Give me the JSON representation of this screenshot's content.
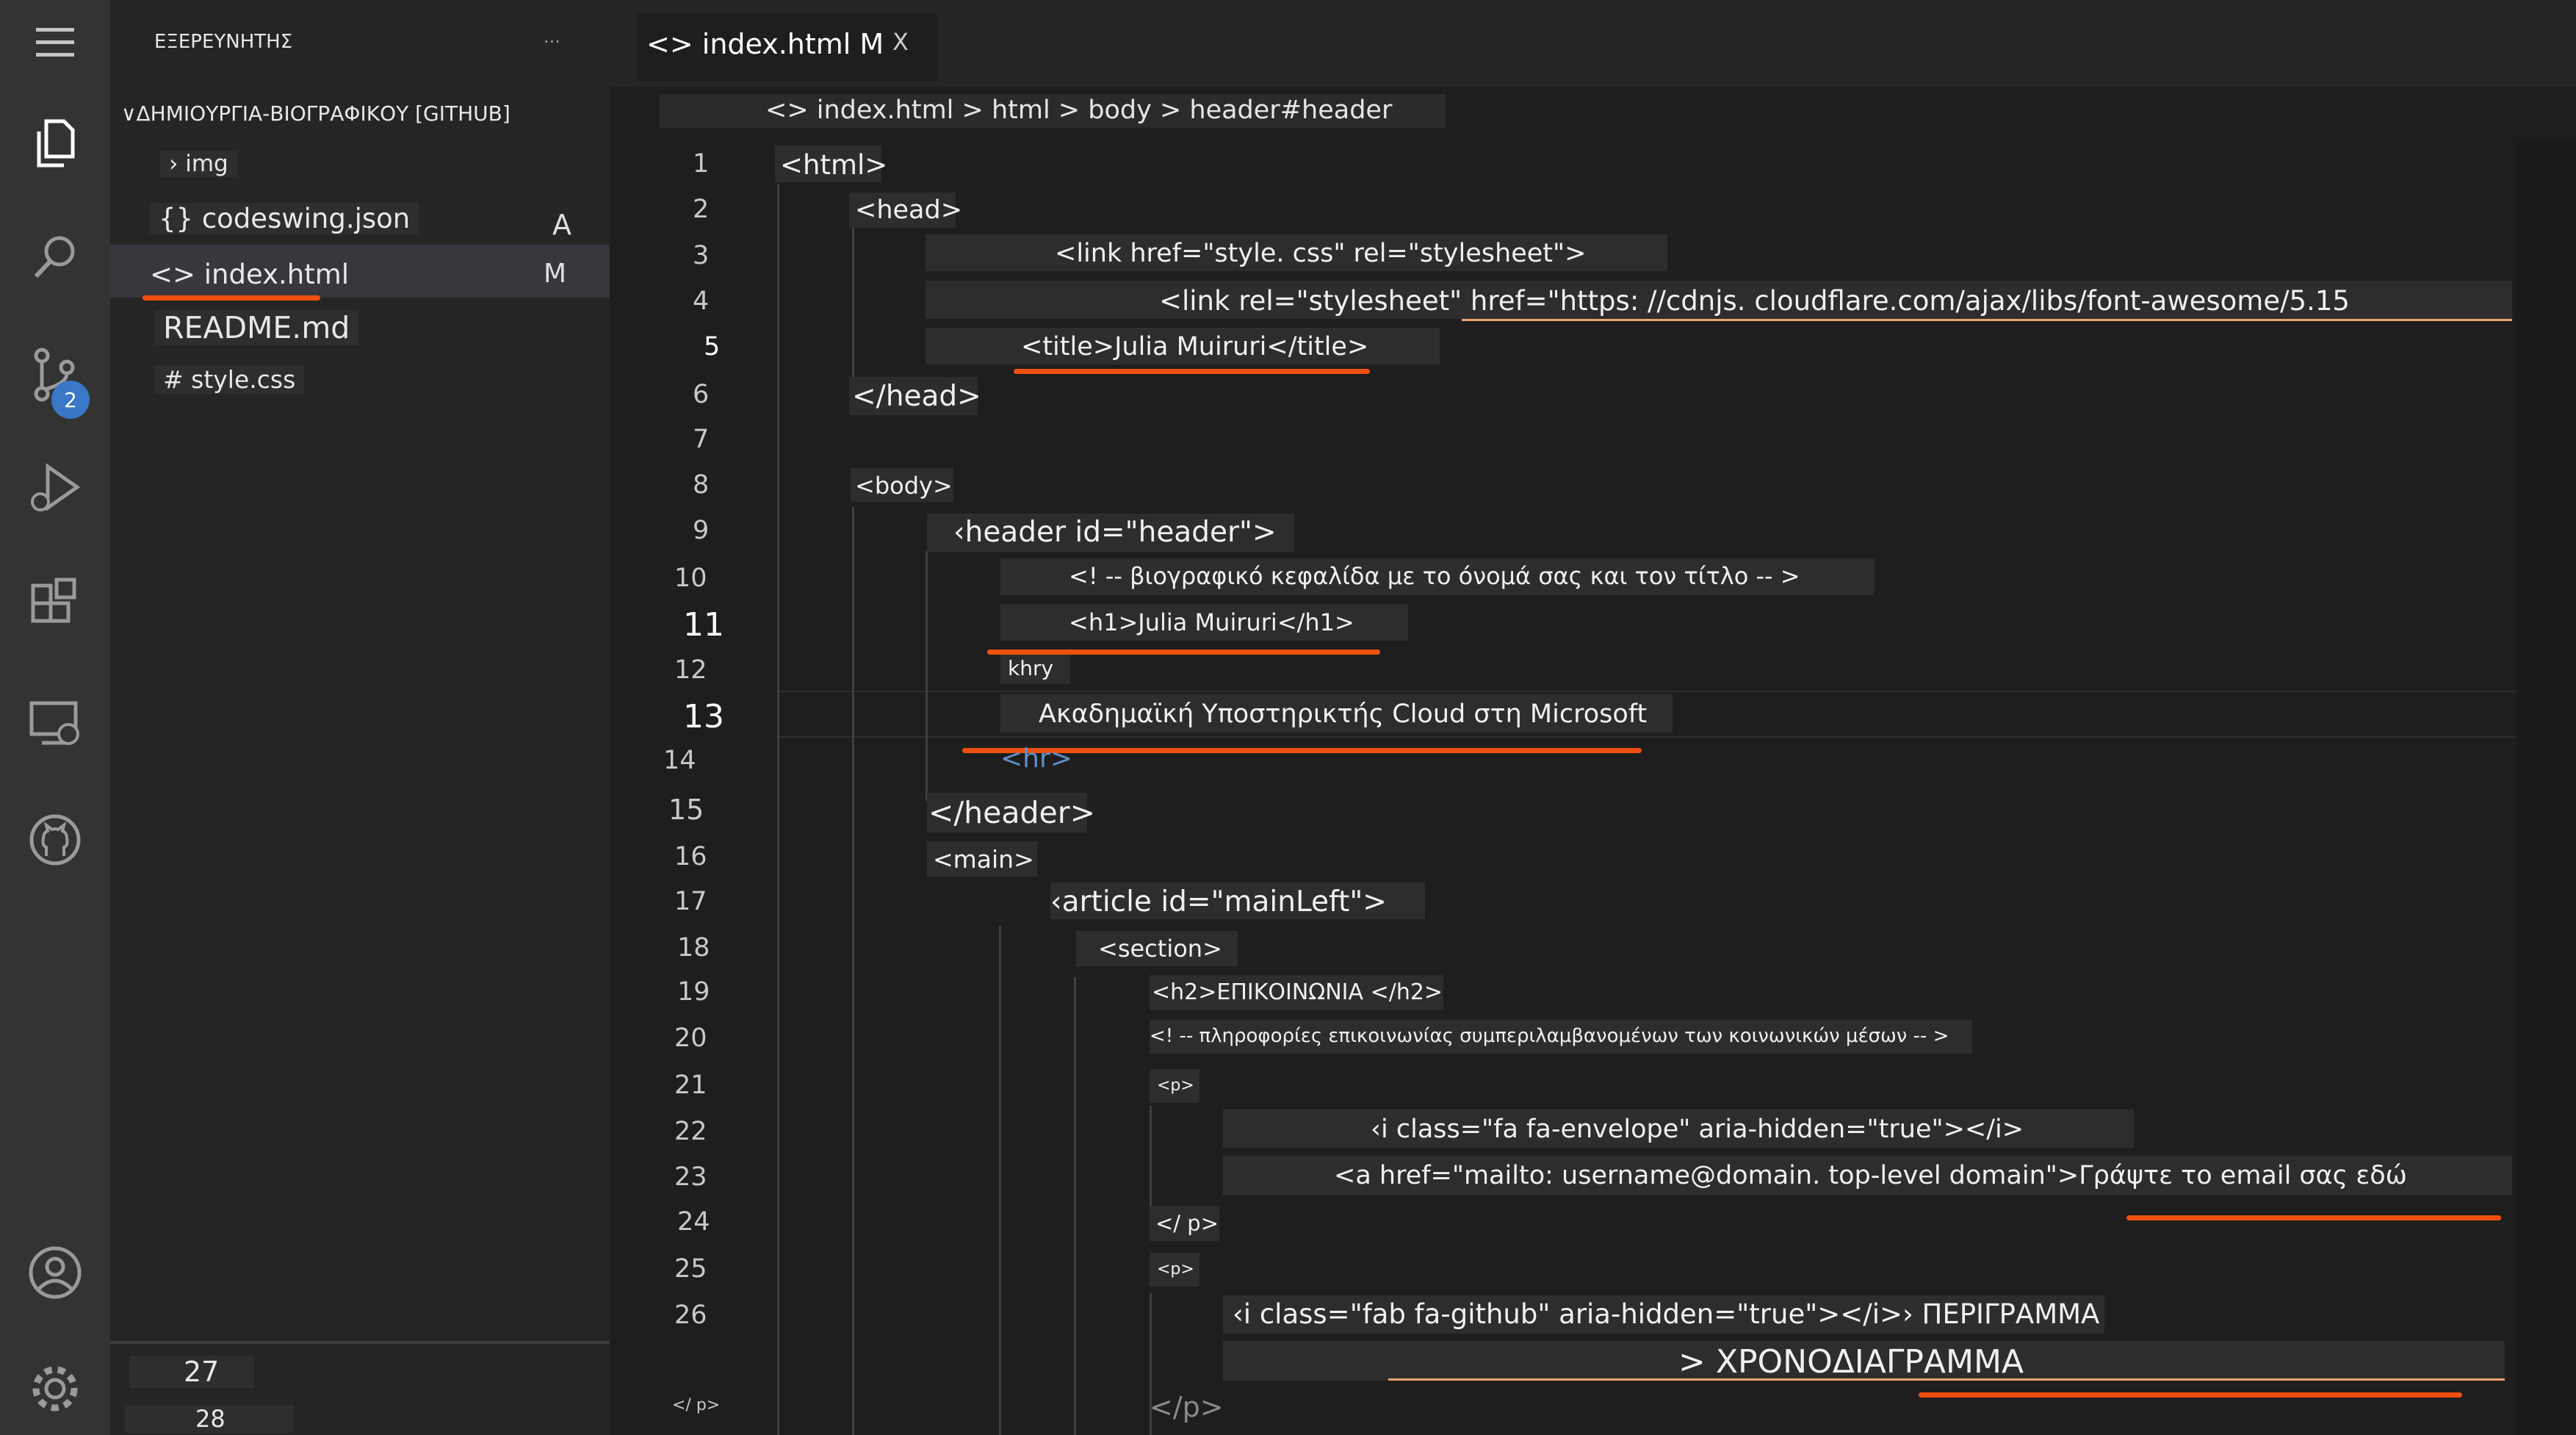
{
  "activity_bar": {
    "icons": [
      "menu-icon",
      "files-icon",
      "search-icon",
      "source-control-icon",
      "run-debug-icon",
      "extensions-icon",
      "remote-explorer-icon",
      "github-icon",
      "account-icon",
      "gear-icon"
    ],
    "scm_badge": "2"
  },
  "explorer": {
    "title": "ΕΞΕΡΕΥΝΗΤΗΣ",
    "more": "...",
    "folder": "ΔΗΜΙΟΥΡΓΙΑ-ΒΙΟΓΡΑΦΙΚΟΥ [GITHUB]",
    "items": [
      {
        "label": "› img",
        "status": ""
      },
      {
        "label": "{} codeswing.json",
        "status": "A"
      },
      {
        "label": "<> index.html",
        "status": "M"
      },
      {
        "label": "README.md",
        "status": ""
      },
      {
        "label": "# style.css",
        "status": ""
      }
    ],
    "bottom_numbers": [
      "27",
      "28"
    ]
  },
  "tab": {
    "label": "<> index.html M",
    "close": "X"
  },
  "breadcrumb": "<> index.html > html > body > header#header",
  "lines": [
    {
      "n": "1",
      "text": "<html>"
    },
    {
      "n": "2",
      "text": "<head>"
    },
    {
      "n": "3",
      "text": "<link href=\"style. css\" rel=\"stylesheet\">"
    },
    {
      "n": "4",
      "text": "<link rel=\"stylesheet\" href=\"https: //cdnjs. cloudflare.com/ajax/libs/font-awesome/5.15"
    },
    {
      "n": "5",
      "text": "<title>Julia Muiruri</title>"
    },
    {
      "n": "6",
      "text": "</head>"
    },
    {
      "n": "7",
      "text": ""
    },
    {
      "n": "8",
      "text": "<body>"
    },
    {
      "n": "9",
      "text": "‹header id=\"header\">"
    },
    {
      "n": "10",
      "text": "<! -- βιογραφικό κεφαλίδα με το όνομά σας και τον τίτλο -- >"
    },
    {
      "n": "11",
      "text": "<h1>Julia Muiruri</h1>"
    },
    {
      "n": "12",
      "text": "khry"
    },
    {
      "n": "13",
      "text": "Ακαδημαϊκή Υποστηρικτής Cloud στη Microsoft"
    },
    {
      "n": "14",
      "text": "<hr>"
    },
    {
      "n": "15",
      "text": "</header>"
    },
    {
      "n": "16",
      "text": "<main>"
    },
    {
      "n": "17",
      "text": "‹article id=\"mainLeft\">"
    },
    {
      "n": "18",
      "text": "<section>"
    },
    {
      "n": "19",
      "text": "<h2>ΕΠΙΚΟΙΝΩΝΙΑ </h2>"
    },
    {
      "n": "20",
      "text": "<! -- πληροφορίες επικοινωνίας συμπεριλαμβανομένων των κοινωνικών μέσων -- >"
    },
    {
      "n": "21",
      "text": "<p>"
    },
    {
      "n": "22",
      "text": "‹i class=\"fa fa-envelope\" aria-hidden=\"true\"></i>"
    },
    {
      "n": "23",
      "text": "<a href=\"mailto: username@domain. top-level domain\">Γράψτε το email σας εδώ"
    },
    {
      "n": "24",
      "text": "</ p>"
    },
    {
      "n": "25",
      "text": "<p>"
    },
    {
      "n": "26",
      "text": "‹i class=\"fab fa-github\" aria-hidden=\"true\"></i>› ΠΕΡΙΓΡΑΜΜΑ"
    },
    {
      "n": "27",
      "text": "> ΧΡΟΝΟΔΙΑΓΡΑΜΜΑ"
    },
    {
      "n": "28",
      "text": "</p>"
    }
  ],
  "bottom_left_tag": "</ p>",
  "colors": {
    "highlight": "#f0500f",
    "activity_bar": "#333333",
    "sidebar": "#252526",
    "editor": "#1e1e1e",
    "badge": "#3a77c7"
  }
}
